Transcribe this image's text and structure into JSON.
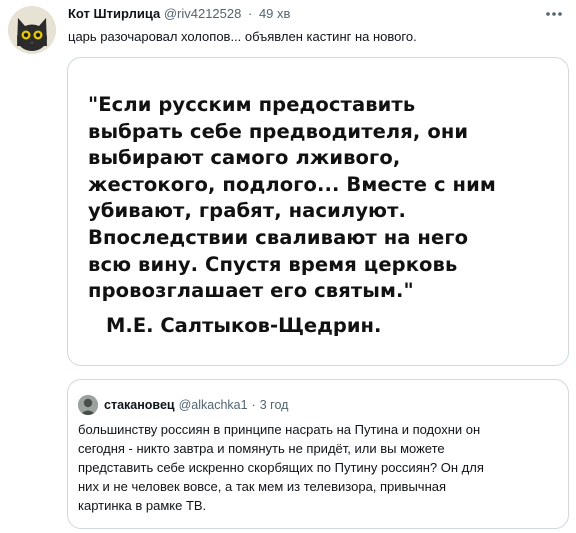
{
  "tweet": {
    "author_name": "Кот Штирлица",
    "author_handle": "@riv4212528",
    "separator": "·",
    "timestamp": "49 хв",
    "text": "царь разочаровал холопов... объявлен кастинг на нового.",
    "avatar_icon": "cat-avatar-icon",
    "more_icon": "more-options-icon"
  },
  "media": {
    "quote_lines": [
      "\"Если русским предоставить",
      "выбрать себе предводителя, они",
      "выбирают самого лживого,",
      "жестокого, подлого...  Вместе с ним",
      "убивают, грабят, насилуют.",
      "Впоследствии сваливают на него",
      "всю вину. Спустя время церковь",
      "провозглашает его святым.\""
    ],
    "author": "М.Е. Салтыков-Щедрин."
  },
  "quoted_tweet": {
    "author_name": "стакановец",
    "author_handle": "@alkachka1",
    "separator": "·",
    "timestamp": "3 год",
    "text_lines": [
      "большинству россиян в принципе насрать на Путина  и подохни он",
      "сегодня - никто завтра и помянуть не придёт, или вы можете",
      "представить себе искренно скорбящих по Путину россиян? Он для",
      "них и не человек вовсе, а так мем  из телевизора, привычная",
      "картинка в рамке ТВ."
    ]
  }
}
